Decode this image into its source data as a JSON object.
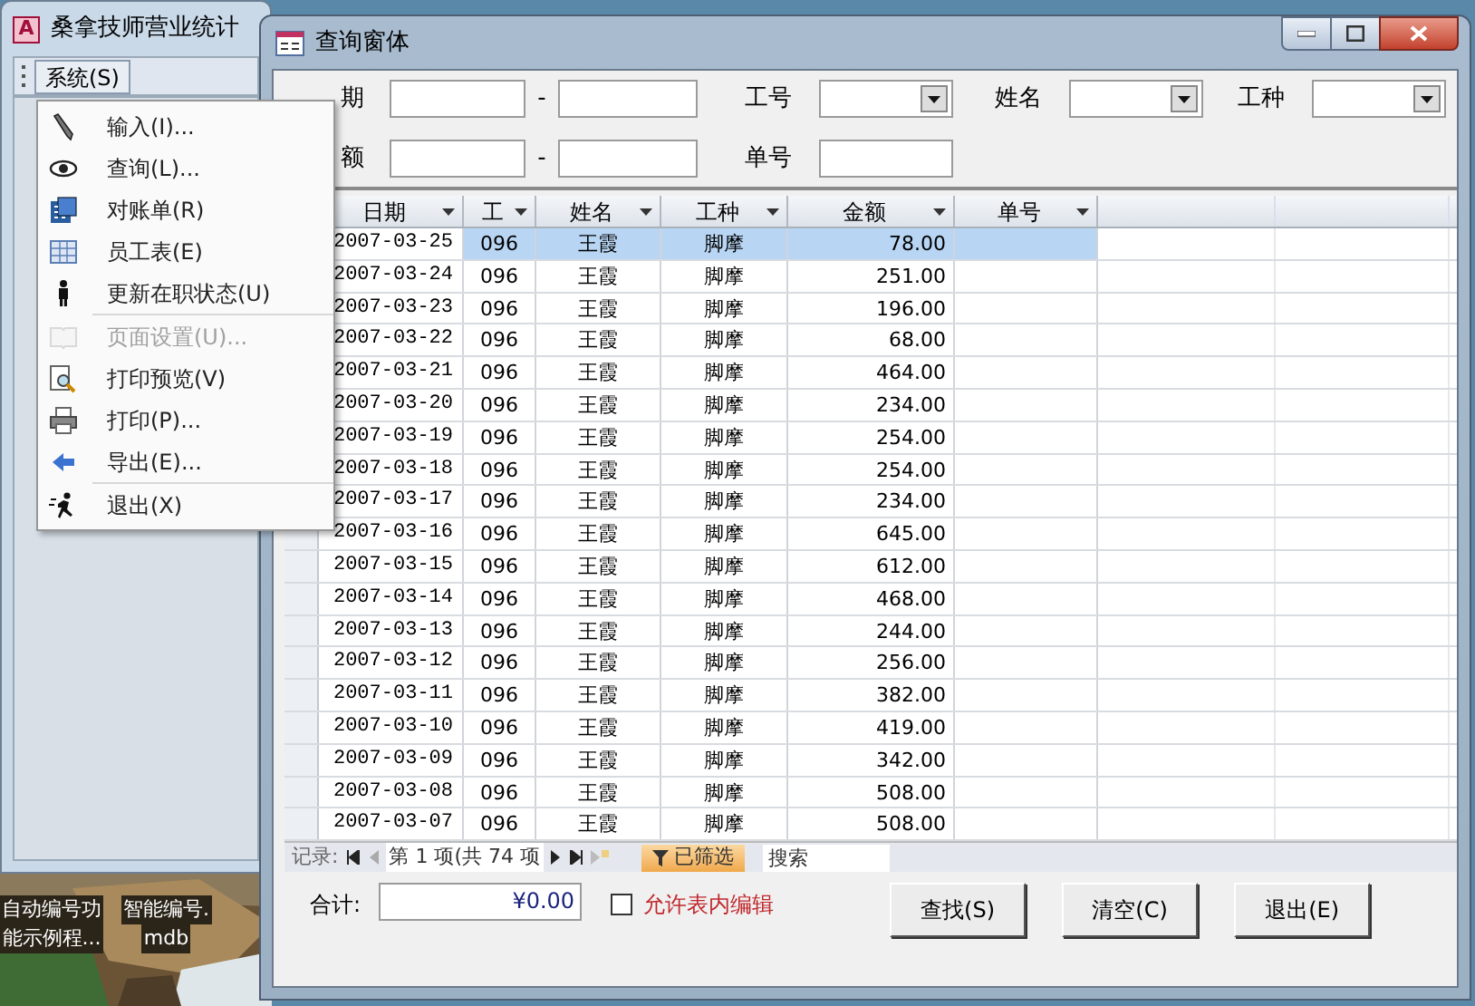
{
  "main_window": {
    "logo": "A",
    "title": "桑拿技师营业统计",
    "menu": [
      {
        "label": "系统(S)",
        "selected": true
      }
    ]
  },
  "dropdown_menu": [
    {
      "label": "输入(I)...",
      "kind": "pencil",
      "disabled": false,
      "separator_after": false
    },
    {
      "label": "查询(L)...",
      "kind": "eye",
      "disabled": false,
      "separator_after": false
    },
    {
      "label": "对账单(R)",
      "kind": "calc",
      "disabled": false,
      "separator_after": false
    },
    {
      "label": "员工表(E)",
      "kind": "table",
      "disabled": false,
      "separator_after": false
    },
    {
      "label": "更新在职状态(U)",
      "kind": "person",
      "disabled": false,
      "separator_after": true
    },
    {
      "label": "页面设置(U)...",
      "kind": "book",
      "disabled": true,
      "separator_after": false
    },
    {
      "label": "打印预览(V)",
      "kind": "preview",
      "disabled": false,
      "separator_after": false
    },
    {
      "label": "打印(P)...",
      "kind": "printer",
      "disabled": false,
      "separator_after": false
    },
    {
      "label": "导出(E)...",
      "kind": "arrow",
      "disabled": false,
      "separator_after": true
    },
    {
      "label": "退出(X)",
      "kind": "run",
      "disabled": false,
      "separator_after": false
    }
  ],
  "desktop_icons": [
    {
      "lines": [
        "自动编号功",
        "能示例程..."
      ]
    },
    {
      "lines": [
        "智能编号.",
        "mdb"
      ]
    }
  ],
  "query_window": {
    "title": "查询窗体",
    "filters": [
      {
        "label": "期",
        "kind": "range"
      },
      {
        "label": "工号",
        "kind": "combo"
      },
      {
        "label": "姓名",
        "kind": "combo"
      },
      {
        "label": "工种",
        "kind": "combo"
      },
      {
        "label": "额",
        "kind": "range"
      },
      {
        "label": "单号",
        "kind": "text"
      }
    ],
    "range_separator": "-",
    "table": {
      "columns": [
        "日期",
        "工",
        "姓名",
        "工种",
        "金额",
        "单号"
      ],
      "rows": [
        {
          "cells": [
            "2007-03-25",
            "096",
            "王霞",
            "脚摩",
            "78.00",
            ""
          ],
          "selected": true
        },
        {
          "cells": [
            "2007-03-24",
            "096",
            "王霞",
            "脚摩",
            "251.00",
            ""
          ],
          "selected": false
        },
        {
          "cells": [
            "2007-03-23",
            "096",
            "王霞",
            "脚摩",
            "196.00",
            ""
          ],
          "selected": false
        },
        {
          "cells": [
            "2007-03-22",
            "096",
            "王霞",
            "脚摩",
            "68.00",
            ""
          ],
          "selected": false
        },
        {
          "cells": [
            "2007-03-21",
            "096",
            "王霞",
            "脚摩",
            "464.00",
            ""
          ],
          "selected": false
        },
        {
          "cells": [
            "2007-03-20",
            "096",
            "王霞",
            "脚摩",
            "234.00",
            ""
          ],
          "selected": false
        },
        {
          "cells": [
            "2007-03-19",
            "096",
            "王霞",
            "脚摩",
            "254.00",
            ""
          ],
          "selected": false
        },
        {
          "cells": [
            "2007-03-18",
            "096",
            "王霞",
            "脚摩",
            "254.00",
            ""
          ],
          "selected": false
        },
        {
          "cells": [
            "2007-03-17",
            "096",
            "王霞",
            "脚摩",
            "234.00",
            ""
          ],
          "selected": false
        },
        {
          "cells": [
            "2007-03-16",
            "096",
            "王霞",
            "脚摩",
            "645.00",
            ""
          ],
          "selected": false
        },
        {
          "cells": [
            "2007-03-15",
            "096",
            "王霞",
            "脚摩",
            "612.00",
            ""
          ],
          "selected": false
        },
        {
          "cells": [
            "2007-03-14",
            "096",
            "王霞",
            "脚摩",
            "468.00",
            ""
          ],
          "selected": false
        },
        {
          "cells": [
            "2007-03-13",
            "096",
            "王霞",
            "脚摩",
            "244.00",
            ""
          ],
          "selected": false
        },
        {
          "cells": [
            "2007-03-12",
            "096",
            "王霞",
            "脚摩",
            "256.00",
            ""
          ],
          "selected": false
        },
        {
          "cells": [
            "2007-03-11",
            "096",
            "王霞",
            "脚摩",
            "382.00",
            ""
          ],
          "selected": false
        },
        {
          "cells": [
            "2007-03-10",
            "096",
            "王霞",
            "脚摩",
            "419.00",
            ""
          ],
          "selected": false
        },
        {
          "cells": [
            "2007-03-09",
            "096",
            "王霞",
            "脚摩",
            "342.00",
            ""
          ],
          "selected": false
        },
        {
          "cells": [
            "2007-03-08",
            "096",
            "王霞",
            "脚摩",
            "508.00",
            ""
          ],
          "selected": false
        },
        {
          "cells": [
            "2007-03-07",
            "096",
            "王霞",
            "脚摩",
            "508.00",
            ""
          ],
          "selected": false
        }
      ]
    },
    "navigator": {
      "label": "记录:",
      "position": "第 1 项(共 74 项",
      "filter": "已筛选",
      "search": "搜索"
    },
    "total_label": "合计:",
    "total_value": "¥0.00",
    "allow_edit": {
      "label": "允许表内编辑",
      "checked": false
    },
    "buttons": [
      "查找(S)",
      "清空(C)",
      "退出(E)"
    ]
  }
}
